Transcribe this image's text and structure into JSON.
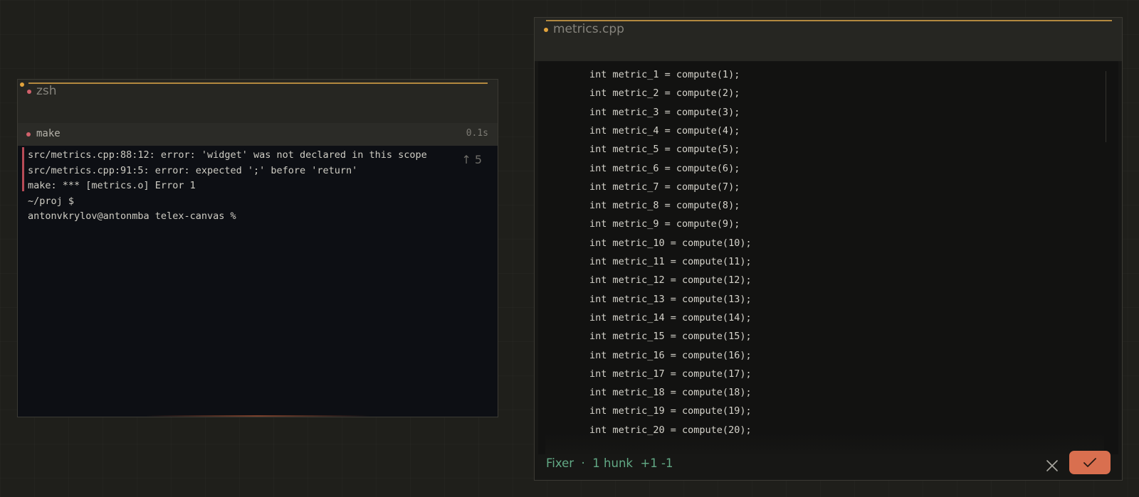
{
  "terminal": {
    "title": "zsh",
    "command": {
      "name": "make",
      "duration": "0.1s"
    },
    "scroll_hint": "↑ 5",
    "lines": [
      "src/metrics.cpp:88:12: error: 'widget' was not declared in this scope",
      "src/metrics.cpp:91:5: error: expected ';' before 'return'",
      "make: *** [metrics.o] Error 1",
      "~/proj $",
      "antonvkrylov@antonmba telex-canvas %"
    ]
  },
  "editor": {
    "title": "metrics.cpp",
    "code_lines": [
      "int metric_1 = compute(1);",
      "int metric_2 = compute(2);",
      "int metric_3 = compute(3);",
      "int metric_4 = compute(4);",
      "int metric_5 = compute(5);",
      "int metric_6 = compute(6);",
      "int metric_7 = compute(7);",
      "int metric_8 = compute(8);",
      "int metric_9 = compute(9);",
      "int metric_10 = compute(10);",
      "int metric_11 = compute(11);",
      "int metric_12 = compute(12);",
      "int metric_13 = compute(13);",
      "int metric_14 = compute(14);",
      "int metric_15 = compute(15);",
      "int metric_16 = compute(16);",
      "int metric_17 = compute(17);",
      "int metric_18 = compute(18);",
      "int metric_19 = compute(19);",
      "int metric_20 = compute(20);"
    ],
    "fixer": {
      "label": "Fixer  ·  1 hunk  +1 -1",
      "close_icon": "close-icon",
      "accept_icon": "check-icon"
    }
  },
  "colors": {
    "accent": "#b3893f",
    "error": "#b74b57",
    "fixer_green": "#62a985",
    "accept_button": "#d96f4f"
  }
}
